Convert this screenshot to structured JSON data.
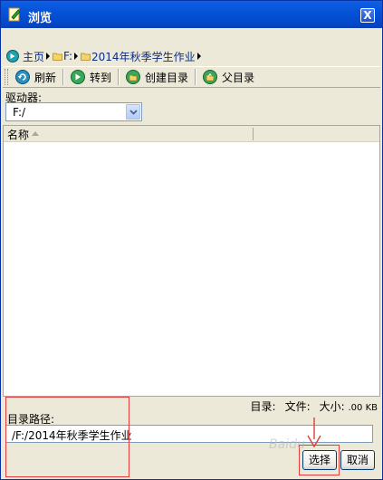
{
  "window": {
    "title": "浏览",
    "close_label": "X"
  },
  "breadcrumb": {
    "home": "主页",
    "drive": "F:",
    "folder": "2014年秋季学生作业"
  },
  "toolbar": {
    "refresh": "刷新",
    "goto": "转到",
    "create_dir": "创建目录",
    "parent_dir": "父目录"
  },
  "drive": {
    "label": "驱动器:",
    "selected": "F:/"
  },
  "list": {
    "column_name": "名称",
    "items": []
  },
  "status": {
    "dir_label": "目录:",
    "file_label": "文件:",
    "size_label": "大小:",
    "size_value": ".00 KB"
  },
  "path": {
    "label": "目录路径:",
    "value": "/F:/2014年秋季学生作业"
  },
  "buttons": {
    "select": "选择",
    "cancel": "取消"
  },
  "watermark": "Baidu",
  "colors": {
    "titlebar": "#0553d8",
    "annotation": "#e23b3b",
    "link": "#0a2c8a"
  }
}
